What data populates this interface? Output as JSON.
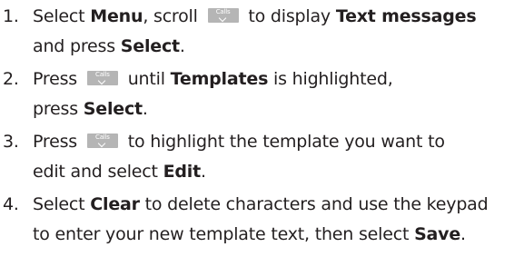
{
  "key_icon": {
    "label": "Calls",
    "color": "#b5b5b5"
  },
  "steps": [
    {
      "number": "1.",
      "line1": {
        "a": "Select ",
        "b": "Menu",
        "c": ", scroll ",
        "d": " to display ",
        "e": "Text messages"
      },
      "line2": {
        "a": "and press ",
        "b": "Select",
        "c": "."
      }
    },
    {
      "number": "2.",
      "line1": {
        "a": "Press ",
        "b": " until ",
        "c": "Templates",
        "d": " is highlighted,"
      },
      "line2": {
        "a": "press ",
        "b": "Select",
        "c": "."
      }
    },
    {
      "number": "3.",
      "line1": {
        "a": "Press ",
        "b": " to highlight the template you want to"
      },
      "line2": {
        "a": "edit and select ",
        "b": "Edit",
        "c": "."
      }
    },
    {
      "number": "4.",
      "line1": {
        "a": "Select ",
        "b": "Clear",
        "c": " to delete characters and use the keypad"
      },
      "line2": {
        "a": "to enter your new template text, then select ",
        "b": "Save",
        "c": "."
      }
    }
  ]
}
